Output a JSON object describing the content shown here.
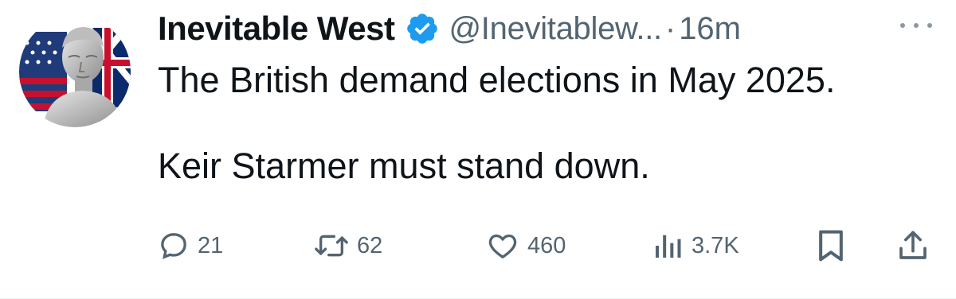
{
  "tweet": {
    "display_name": "Inevitable West",
    "handle": "@Inevitablew...",
    "separator": "·",
    "time": "16m",
    "text_line1": "The British demand elections in May 2025.",
    "text_line2": "Keir Starmer must stand down.",
    "verified": true
  },
  "actions": {
    "replies": "21",
    "reposts": "62",
    "likes": "460",
    "views": "3.7K"
  },
  "icons": {
    "verified": "verified-badge-icon",
    "more": "more-options-icon",
    "reply": "reply-icon",
    "repost": "repost-icon",
    "like": "heart-icon",
    "views": "views-bar-chart-icon",
    "bookmark": "bookmark-icon",
    "share": "share-icon"
  },
  "colors": {
    "text": "#0f1419",
    "secondary": "#536471",
    "verified_blue": "#1d9bf0"
  }
}
